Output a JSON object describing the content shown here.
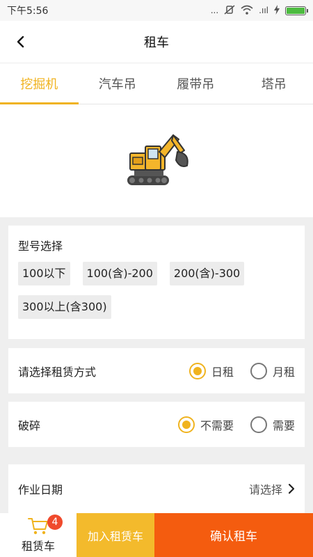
{
  "status_bar": {
    "time": "下午5:56",
    "dots": "...",
    "signal": ".ııl"
  },
  "nav": {
    "title": "租车"
  },
  "tabs": [
    {
      "label": "挖掘机",
      "active": true
    },
    {
      "label": "汽车吊",
      "active": false
    },
    {
      "label": "履带吊",
      "active": false
    },
    {
      "label": "塔吊",
      "active": false
    }
  ],
  "model_select": {
    "title": "型号选择",
    "options": [
      "100以下",
      "100(含)-200",
      "200(含)-300",
      "300以上(含300)"
    ]
  },
  "rent_mode": {
    "label": "请选择租赁方式",
    "options": [
      {
        "label": "日租",
        "selected": true
      },
      {
        "label": "月租",
        "selected": false
      }
    ]
  },
  "breaking": {
    "label": "破碎",
    "options": [
      {
        "label": "不需要",
        "selected": true
      },
      {
        "label": "需要",
        "selected": false
      }
    ]
  },
  "work_date": {
    "label": "作业日期",
    "value": "请选择"
  },
  "bottom_bar": {
    "cart_label": "租赁车",
    "cart_count": "4",
    "add_label": "加入租赁车",
    "confirm_label": "确认租车"
  },
  "colors": {
    "accent": "#f0b31e",
    "confirm": "#f45c0f",
    "badge": "#f04a2c"
  }
}
